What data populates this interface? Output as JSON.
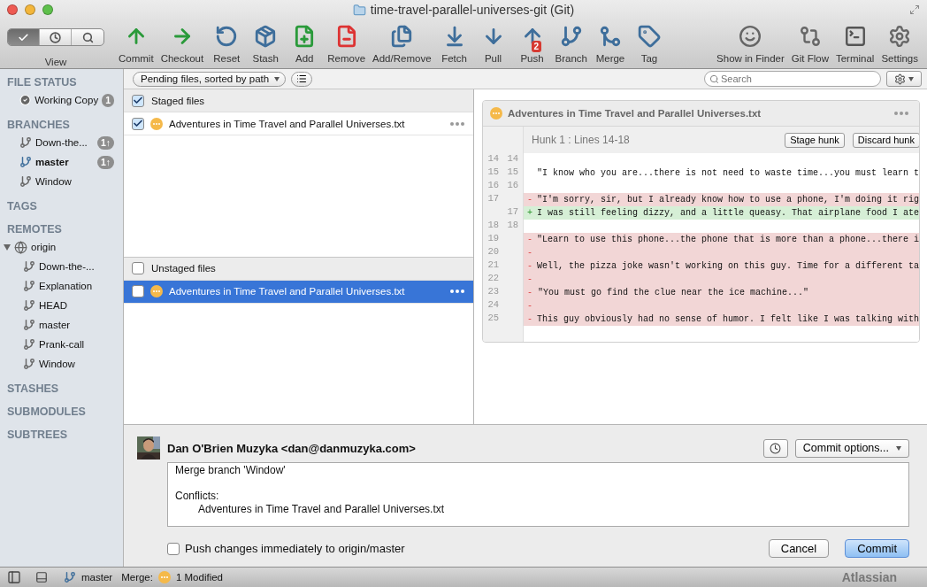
{
  "window": {
    "title": "time-travel-parallel-universes-git (Git)"
  },
  "toolbar": {
    "view": {
      "label": "View",
      "segments": [
        {
          "selected": true
        },
        {
          "selected": false
        },
        {
          "selected": false
        }
      ]
    },
    "actions": [
      {
        "label": "Commit"
      },
      {
        "label": "Checkout"
      },
      {
        "label": "Reset"
      },
      {
        "label": "Stash"
      },
      {
        "label": "Add"
      },
      {
        "label": "Remove"
      },
      {
        "label": "Add/Remove"
      },
      {
        "label": "Fetch"
      },
      {
        "label": "Pull"
      },
      {
        "label": "Push",
        "badge": "2"
      },
      {
        "label": "Branch"
      },
      {
        "label": "Merge"
      },
      {
        "label": "Tag"
      }
    ],
    "tools": [
      {
        "label": "Show in Finder"
      },
      {
        "label": "Git Flow"
      },
      {
        "label": "Terminal"
      },
      {
        "label": "Settings"
      }
    ]
  },
  "sidebar": {
    "sections": [
      {
        "title": "FILE STATUS",
        "items": [
          {
            "kind": "status",
            "label": "Working Copy",
            "badge": "1",
            "current": false
          }
        ]
      },
      {
        "title": "BRANCHES",
        "items": [
          {
            "kind": "branch",
            "label": "Down-the...",
            "badge": "1↑",
            "current": false
          },
          {
            "kind": "branch",
            "label": "master",
            "badge": "1↑",
            "current": true
          },
          {
            "kind": "branch",
            "label": "Window",
            "current": false
          }
        ]
      },
      {
        "title": "TAGS"
      },
      {
        "title": "REMOTES",
        "items": [
          {
            "kind": "remote",
            "label": "origin",
            "expanded": true,
            "current": false,
            "children": [
              {
                "kind": "branch",
                "label": "Down-the-...",
                "current": false
              },
              {
                "kind": "branch",
                "label": "Explanation",
                "current": false
              },
              {
                "kind": "branch",
                "label": "HEAD",
                "current": false
              },
              {
                "kind": "branch",
                "label": "master",
                "current": false
              },
              {
                "kind": "branch",
                "label": "Prank-call",
                "current": false
              },
              {
                "kind": "branch",
                "label": "Window",
                "current": false
              }
            ]
          }
        ]
      },
      {
        "title": "STASHES"
      },
      {
        "title": "SUBMODULES"
      },
      {
        "title": "SUBTREES"
      }
    ]
  },
  "filter": {
    "label": "Pending files, sorted by path"
  },
  "search": {
    "placeholder": "Search"
  },
  "file_lists": [
    {
      "title": "Staged files",
      "checked": true,
      "files": [
        {
          "name": "Adventures in Time Travel and Parallel Universes.txt",
          "checked": true,
          "selected": false
        }
      ]
    },
    {
      "title": "Unstaged files",
      "checked": false,
      "files": [
        {
          "name": "Adventures in Time Travel and Parallel Universes.txt",
          "checked": false,
          "selected": true
        }
      ]
    }
  ],
  "diff": {
    "file": "Adventures in Time Travel and Parallel Universes.txt",
    "hunk": {
      "title": "Hunk 1 : Lines 14-18",
      "buttons": [
        "Stage hunk",
        "Discard hunk"
      ]
    },
    "lines": [
      {
        "kind": "context",
        "old": "14",
        "new": "14"
      },
      {
        "kind": "context",
        "old": "15",
        "new": "15",
        "text": "\"I know who you are...there is not need to waste time...you must learn t"
      },
      {
        "kind": "context",
        "old": "16",
        "new": "16"
      },
      {
        "kind": "removed",
        "old": "17",
        "sign": "-",
        "text": "\"I'm sorry, sir, but I already know how to use a phone, I'm doing it rig"
      },
      {
        "kind": "added",
        "new": "17",
        "sign": "+",
        "text": "I was still feeling dizzy, and a little queasy. That airplane food I ate"
      },
      {
        "kind": "context",
        "old": "18",
        "new": "18"
      },
      {
        "kind": "removed",
        "old": "19",
        "sign": "-",
        "text": "\"Learn to use this phone...the phone that is more than a phone...there i"
      },
      {
        "kind": "removed",
        "old": "20",
        "sign": "-"
      },
      {
        "kind": "removed",
        "old": "21",
        "sign": "-",
        "text": "Well, the pizza joke wasn't working on this guy. Time for a different ta"
      },
      {
        "kind": "removed",
        "old": "22",
        "sign": "-"
      },
      {
        "kind": "removed",
        "old": "23",
        "sign": "-",
        "text": "\"You must go find the clue near the ice machine...\""
      },
      {
        "kind": "removed",
        "old": "24",
        "sign": "-"
      },
      {
        "kind": "removed",
        "old": "25",
        "sign": "-",
        "text": "This guy obviously had no sense of humor. I felt like I was talking with"
      }
    ]
  },
  "commit": {
    "author": "Dan O'Brien Muzyka <dan@danmuzyka.com>",
    "options": "Commit options...",
    "message": [
      {
        "text": "Merge branch 'Window'",
        "indent": false
      },
      {
        "text": "Conflicts:",
        "indent": false
      },
      {
        "text": "Adventures in Time Travel and Parallel Universes.txt",
        "indent": true
      }
    ],
    "push": {
      "label": "Push changes immediately to origin/master",
      "checked": false
    },
    "buttons": [
      {
        "label": "Cancel",
        "default": false
      },
      {
        "label": "Commit",
        "default": true
      }
    ]
  },
  "status_bar": {
    "branch": "master",
    "merge_label": "Merge:",
    "modified": "1 Modified",
    "brand": "Atlassian"
  }
}
